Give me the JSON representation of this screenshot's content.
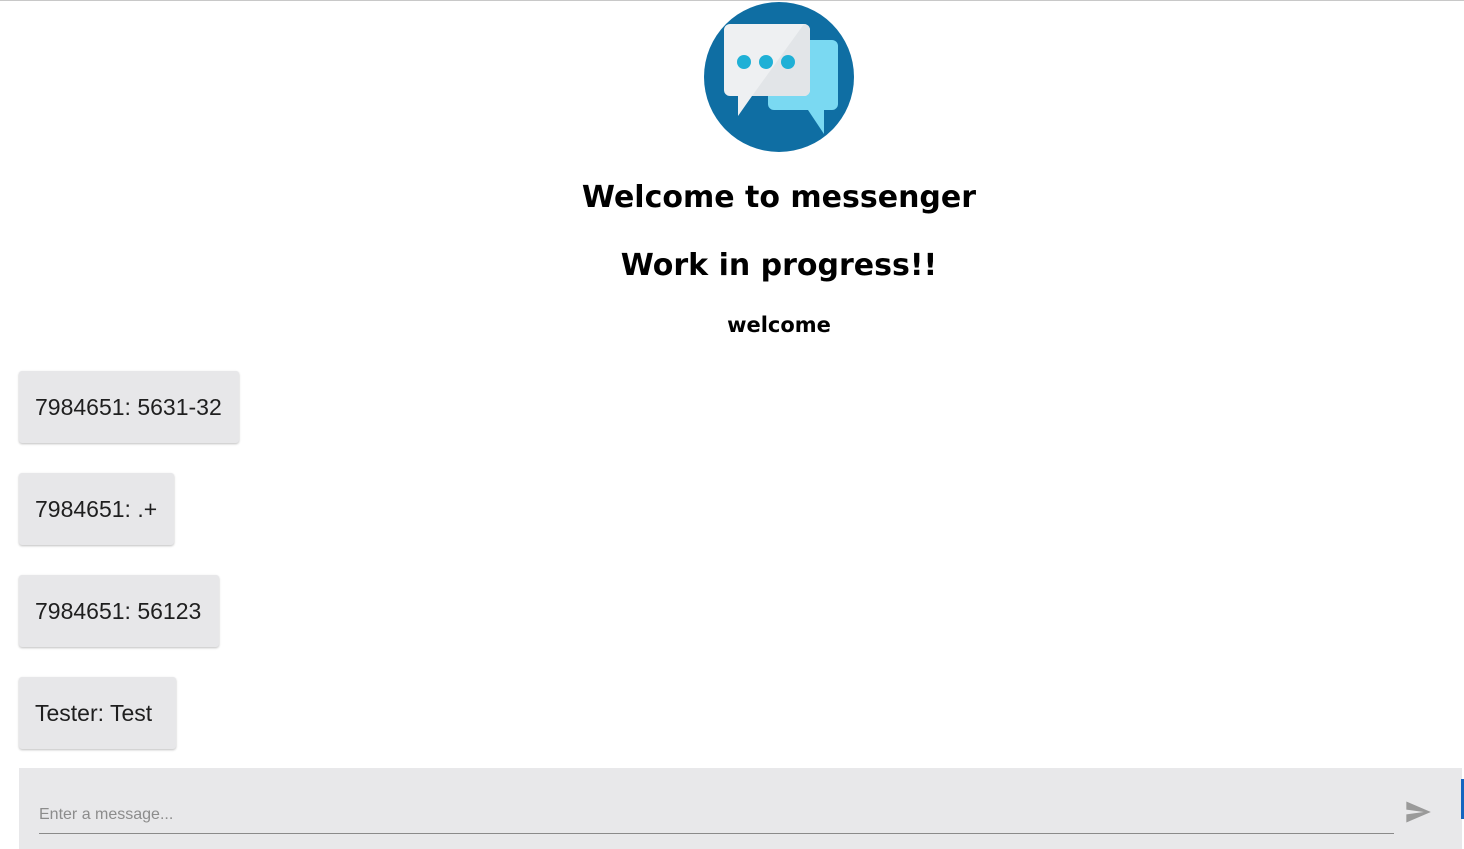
{
  "header": {
    "logo_icon": "chat-bubbles-icon",
    "title": "Welcome to messenger",
    "subtitle": "Work in progress!!",
    "greeting": "welcome"
  },
  "messages": [
    {
      "text": "7984651: 5631-32"
    },
    {
      "text": "7984651: .+"
    },
    {
      "text": "7984651: 56123"
    },
    {
      "text": "Tester: Test"
    }
  ],
  "composer": {
    "placeholder": "Enter a message...",
    "value": "",
    "send_icon": "send-icon"
  },
  "colors": {
    "logo_circle": "#0f6ea3",
    "logo_bubble_front": "#eef0f2",
    "logo_bubble_back": "#7ad9f2",
    "logo_dots": "#1fb0d6",
    "message_bg": "#e7e7e9",
    "composer_bg": "#e8e8ea"
  }
}
